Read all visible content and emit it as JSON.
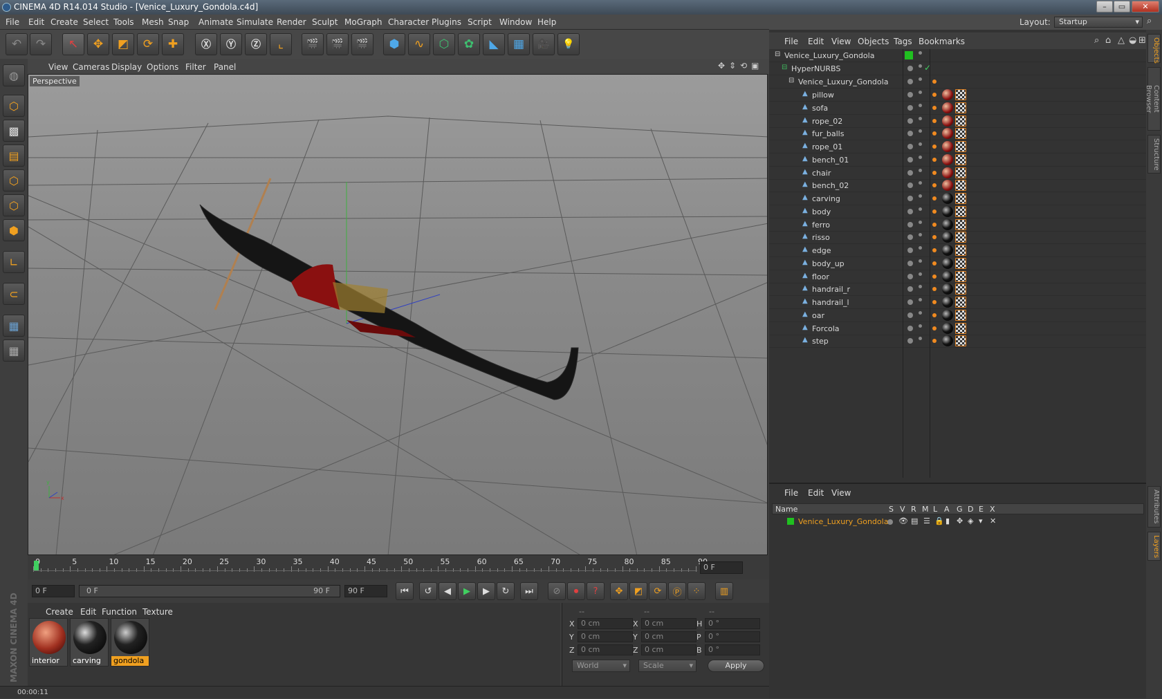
{
  "window": {
    "title": "CINEMA 4D R14.014 Studio - [Venice_Luxury_Gondola.c4d]"
  },
  "menu": [
    "File",
    "Edit",
    "Create",
    "Select",
    "Tools",
    "Mesh",
    "Snap",
    "Animate",
    "Simulate",
    "Render",
    "Sculpt",
    "MoGraph",
    "Character",
    "Plugins",
    "Script",
    "Window",
    "Help"
  ],
  "layout": {
    "label": "Layout:",
    "value": "Startup"
  },
  "viewport": {
    "menu": [
      "View",
      "Cameras",
      "Display",
      "Options",
      "Filter",
      "Panel"
    ],
    "label": "Perspective"
  },
  "timeline": {
    "ticks": [
      "0",
      "5",
      "10",
      "15",
      "20",
      "25",
      "30",
      "35",
      "40",
      "45",
      "50",
      "55",
      "60",
      "65",
      "70",
      "75",
      "80",
      "85",
      "90"
    ],
    "frame_display": "0 F",
    "start": "0 F",
    "slider_left": "0 F",
    "slider_right": "90 F",
    "end": "90 F"
  },
  "materials": {
    "menu": [
      "Create",
      "Edit",
      "Function",
      "Texture"
    ],
    "items": [
      {
        "label": "interior",
        "selected": false
      },
      {
        "label": "carving",
        "selected": false
      },
      {
        "label": "gondola",
        "selected": true
      }
    ]
  },
  "coords": {
    "headers": [
      "--",
      "--",
      "--"
    ],
    "rows": [
      {
        "a": "X",
        "av": "0 cm",
        "b": "X",
        "bv": "0 cm",
        "c": "H",
        "cv": "0 °"
      },
      {
        "a": "Y",
        "av": "0 cm",
        "b": "Y",
        "bv": "0 cm",
        "c": "P",
        "cv": "0 °"
      },
      {
        "a": "Z",
        "av": "0 cm",
        "b": "Z",
        "bv": "0 cm",
        "c": "B",
        "cv": "0 °"
      }
    ],
    "mode": "World",
    "transform": "Scale",
    "apply": "Apply"
  },
  "status": {
    "time": "00:00:11"
  },
  "brand": {
    "text": "MAXON CINEMA 4D"
  },
  "objects": {
    "menu": [
      "File",
      "Edit",
      "View",
      "Objects",
      "Tags",
      "Bookmarks"
    ],
    "root": "Venice_Luxury_Gondola",
    "nurbs": "HyperNURBS",
    "group": "Venice_Luxury_Gondola",
    "children": [
      {
        "name": "pillow",
        "mat": "red"
      },
      {
        "name": "sofa",
        "mat": "red"
      },
      {
        "name": "rope_02",
        "mat": "red"
      },
      {
        "name": "fur_balls",
        "mat": "red"
      },
      {
        "name": "rope_01",
        "mat": "red"
      },
      {
        "name": "bench_01",
        "mat": "red"
      },
      {
        "name": "chair",
        "mat": "red"
      },
      {
        "name": "bench_02",
        "mat": "red"
      },
      {
        "name": "carving",
        "mat": "blk"
      },
      {
        "name": "body",
        "mat": "blk"
      },
      {
        "name": "ferro",
        "mat": "blk"
      },
      {
        "name": "risso",
        "mat": "blk"
      },
      {
        "name": "edge",
        "mat": "blk"
      },
      {
        "name": "body_up",
        "mat": "blk"
      },
      {
        "name": "floor",
        "mat": "blk"
      },
      {
        "name": "handrail_r",
        "mat": "blk"
      },
      {
        "name": "handrail_l",
        "mat": "blk"
      },
      {
        "name": "oar",
        "mat": "blk"
      },
      {
        "name": "Forcola",
        "mat": "blk"
      },
      {
        "name": "step",
        "mat": "blk"
      }
    ]
  },
  "layers": {
    "menu": [
      "File",
      "Edit",
      "View"
    ],
    "columns": [
      "Name",
      "S",
      "V",
      "R",
      "M",
      "L",
      "A",
      "G",
      "D",
      "E",
      "X"
    ],
    "items": [
      "Venice_Luxury_Gondola"
    ]
  },
  "sidetabs": [
    "Objects",
    "Content Browser",
    "Structure",
    "Attributes",
    "Layers"
  ],
  "colors": {
    "accent": "#f0a020",
    "layer_green": "#20c020",
    "viewport": "#8a8a8a"
  }
}
